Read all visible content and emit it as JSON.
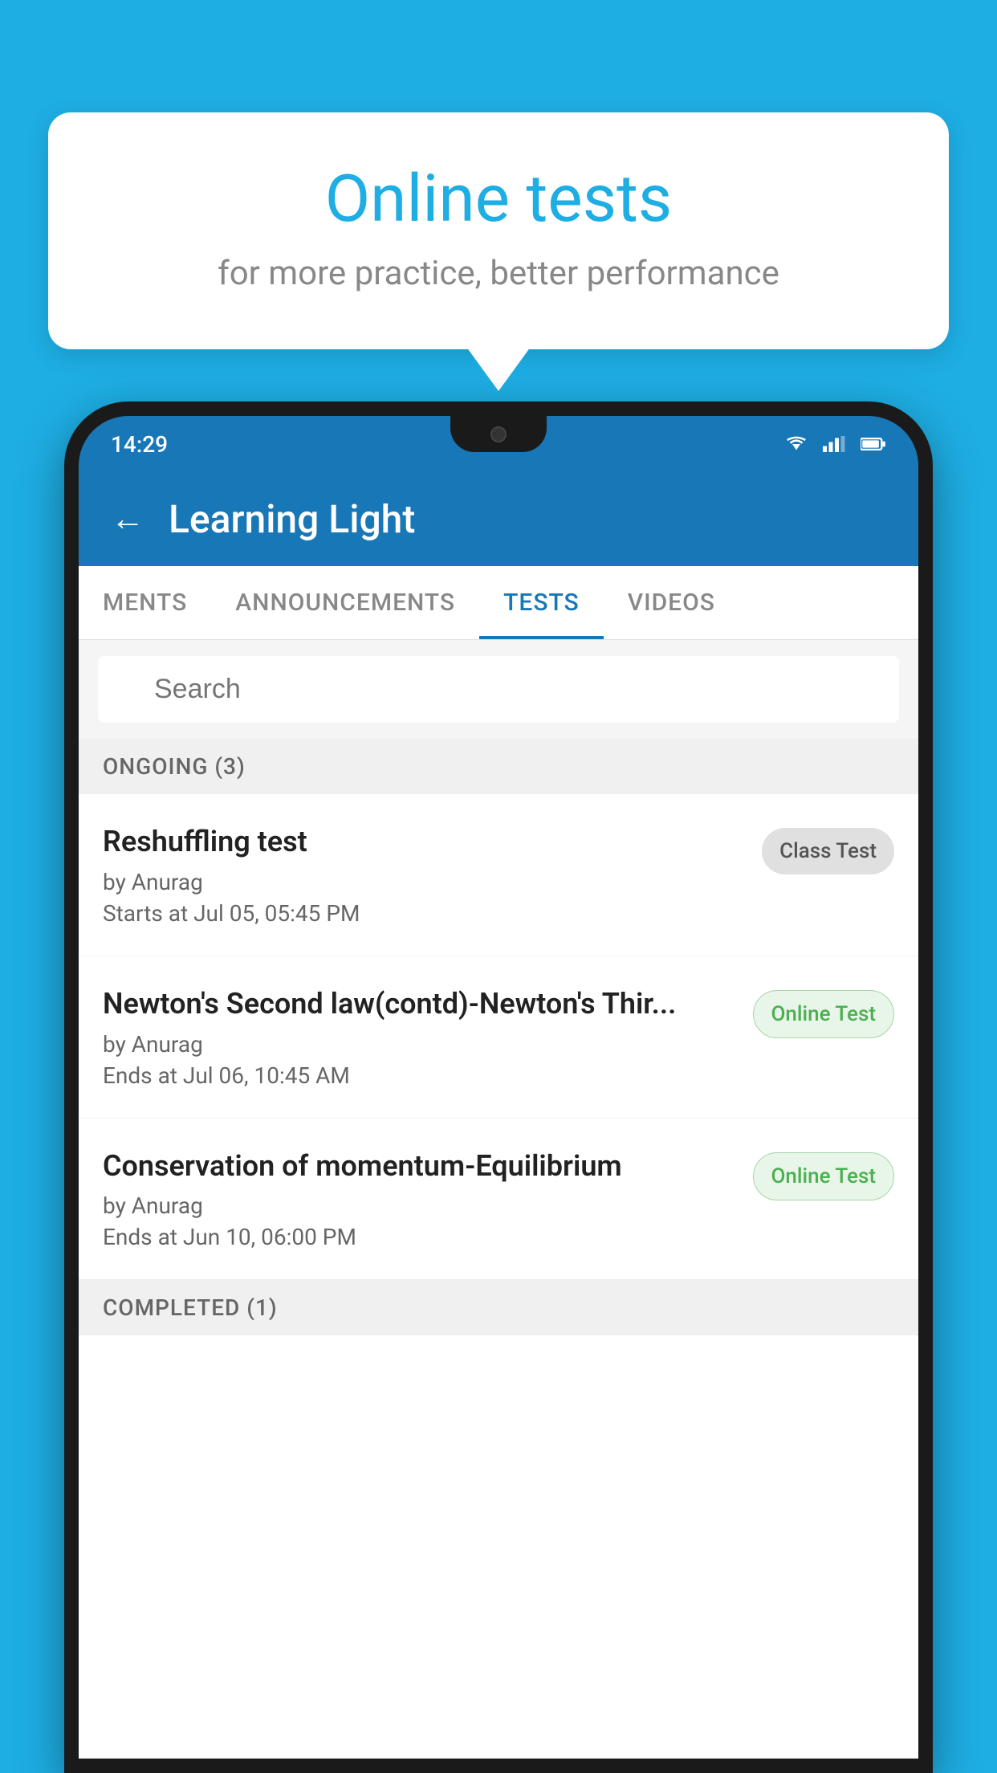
{
  "background_color": "#1EAEE4",
  "bubble": {
    "title": "Online tests",
    "subtitle": "for more practice, better performance"
  },
  "phone": {
    "status_time": "14:29",
    "app_title": "Learning Light",
    "back_label": "←"
  },
  "tabs": [
    {
      "label": "MENTS",
      "active": false
    },
    {
      "label": "ANNOUNCEMENTS",
      "active": false
    },
    {
      "label": "TESTS",
      "active": true
    },
    {
      "label": "VIDEOS",
      "active": false
    }
  ],
  "search": {
    "placeholder": "Search"
  },
  "ongoing_section": {
    "label": "ONGOING (3)"
  },
  "tests": [
    {
      "name": "Reshuffling test",
      "author": "by Anurag",
      "time": "Starts at  Jul 05, 05:45 PM",
      "badge": "Class Test",
      "badge_type": "class"
    },
    {
      "name": "Newton's Second law(contd)-Newton's Thir...",
      "author": "by Anurag",
      "time": "Ends at  Jul 06, 10:45 AM",
      "badge": "Online Test",
      "badge_type": "online"
    },
    {
      "name": "Conservation of momentum-Equilibrium",
      "author": "by Anurag",
      "time": "Ends at  Jun 10, 06:00 PM",
      "badge": "Online Test",
      "badge_type": "online"
    }
  ],
  "completed_section": {
    "label": "COMPLETED (1)"
  }
}
